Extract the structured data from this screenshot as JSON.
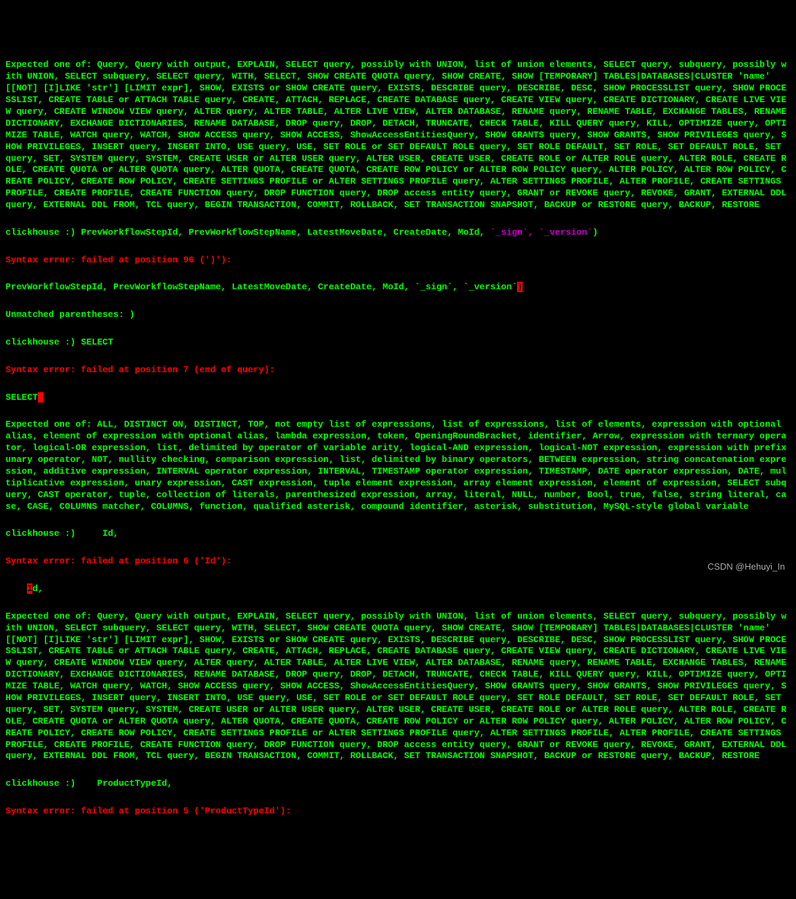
{
  "expected1": "Expected one of: Query, Query with output, EXPLAIN, SELECT query, possibly with UNION, list of union elements, SELECT query, subquery, possibly with UNION, SELECT subquery, SELECT query, WITH, SELECT, SHOW CREATE QUOTA query, SHOW CREATE, SHOW [TEMPORARY] TABLES|DATABASES|CLUSTER 'name' [[NOT] [I]LIKE 'str'] [LIMIT expr], SHOW, EXISTS or SHOW CREATE query, EXISTS, DESCRIBE query, DESCRIBE, DESC, SHOW PROCESSLIST query, SHOW PROCESSLIST, CREATE TABLE or ATTACH TABLE query, CREATE, ATTACH, REPLACE, CREATE DATABASE query, CREATE VIEW query, CREATE DICTIONARY, CREATE LIVE VIEW query, CREATE WINDOW VIEW query, ALTER query, ALTER TABLE, ALTER LIVE VIEW, ALTER DATABASE, RENAME query, RENAME TABLE, EXCHANGE TABLES, RENAME DICTIONARY, EXCHANGE DICTIONARIES, RENAME DATABASE, DROP query, DROP, DETACH, TRUNCATE, CHECK TABLE, KILL QUERY query, KILL, OPTIMIZE query, OPTIMIZE TABLE, WATCH query, WATCH, SHOW ACCESS query, SHOW ACCESS, ShowAccessEntitiesQuery, SHOW GRANTS query, SHOW GRANTS, SHOW PRIVILEGES query, SHOW PRIVILEGES, INSERT query, INSERT INTO, USE query, USE, SET ROLE or SET DEFAULT ROLE query, SET ROLE DEFAULT, SET ROLE, SET DEFAULT ROLE, SET query, SET, SYSTEM query, SYSTEM, CREATE USER or ALTER USER query, ALTER USER, CREATE USER, CREATE ROLE or ALTER ROLE query, ALTER ROLE, CREATE ROLE, CREATE QUOTA or ALTER QUOTA query, ALTER QUOTA, CREATE QUOTA, CREATE ROW POLICY or ALTER ROW POLICY query, ALTER POLICY, ALTER ROW POLICY, CREATE POLICY, CREATE ROW POLICY, CREATE SETTINGS PROFILE or ALTER SETTINGS PROFILE query, ALTER SETTINGS PROFILE, ALTER PROFILE, CREATE SETTINGS PROFILE, CREATE PROFILE, CREATE FUNCTION query, DROP FUNCTION query, DROP access entity query, GRANT or REVOKE query, REVOKE, GRANT, EXTERNAL DDL query, EXTERNAL DDL FROM, TCL query, BEGIN TRANSACTION, COMMIT, ROLLBACK, SET TRANSACTION SNAPSHOT, BACKUP or RESTORE query, BACKUP, RESTORE",
  "prompt1_a": "clickhouse :) PrevWorkflowStepId, PrevWorkflowStepName, LatestMoveDate, CreateDate, MoId, ",
  "prompt1_b": "`_sign`, `_version`",
  "prompt1_c": ")",
  "err1": "Syntax error: failed at position 96 (')'):",
  "echo1_a": "PrevWorkflowStepId, PrevWorkflowStepName, LatestMoveDate, CreateDate, MoId, `_sign`, `_version`",
  "echo1_b": ")",
  "unmatched": "Unmatched parentheses: )",
  "prompt2": "clickhouse :) SELECT",
  "err2": "Syntax error: failed at position 7 (end of query):",
  "select_word": "SELECT",
  "expected2": "Expected one of: ALL, DISTINCT ON, DISTINCT, TOP, not empty list of expressions, list of expressions, list of elements, expression with optional alias, element of expression with optional alias, lambda expression, token, OpeningRoundBracket, identifier, Arrow, expression with ternary operator, logical-OR expression, list, delimited by operator of variable arity, logical-AND expression, logical-NOT expression, expression with prefix unary operator, NOT, nullity checking, comparison expression, list, delimited by binary operators, BETWEEN expression, string concatenation expression, additive expression, INTERVAL operator expression, INTERVAL, TIMESTAMP operator expression, TIMESTAMP, DATE operator expression, DATE, multiplicative expression, unary expression, CAST expression, tuple element expression, array element expression, element of expression, SELECT subquery, CAST operator, tuple, collection of literals, parenthesized expression, array, literal, NULL, number, Bool, true, false, string literal, case, CASE, COLUMNS matcher, COLUMNS, function, qualified asterisk, compound identifier, asterisk, substitution, MySQL-style global variable",
  "prompt3": "clickhouse :)     Id,",
  "err3": "Syntax error: failed at position 6 ('Id'):",
  "id_indent": "    ",
  "id_hl": "I",
  "id_rest": "d,",
  "expected3": "Expected one of: Query, Query with output, EXPLAIN, SELECT query, possibly with UNION, list of union elements, SELECT query, subquery, possibly with UNION, SELECT subquery, SELECT query, WITH, SELECT, SHOW CREATE QUOTA query, SHOW CREATE, SHOW [TEMPORARY] TABLES|DATABASES|CLUSTER 'name' [[NOT] [I]LIKE 'str'] [LIMIT expr], SHOW, EXISTS or SHOW CREATE query, EXISTS, DESCRIBE query, DESCRIBE, DESC, SHOW PROCESSLIST query, SHOW PROCESSLIST, CREATE TABLE or ATTACH TABLE query, CREATE, ATTACH, REPLACE, CREATE DATABASE query, CREATE VIEW query, CREATE DICTIONARY, CREATE LIVE VIEW query, CREATE WINDOW VIEW query, ALTER query, ALTER TABLE, ALTER LIVE VIEW, ALTER DATABASE, RENAME query, RENAME TABLE, EXCHANGE TABLES, RENAME DICTIONARY, EXCHANGE DICTIONARIES, RENAME DATABASE, DROP query, DROP, DETACH, TRUNCATE, CHECK TABLE, KILL QUERY query, KILL, OPTIMIZE query, OPTIMIZE TABLE, WATCH query, WATCH, SHOW ACCESS query, SHOW ACCESS, ShowAccessEntitiesQuery, SHOW GRANTS query, SHOW GRANTS, SHOW PRIVILEGES query, SHOW PRIVILEGES, INSERT query, INSERT INTO, USE query, USE, SET ROLE or SET DEFAULT ROLE query, SET ROLE DEFAULT, SET ROLE, SET DEFAULT ROLE, SET query, SET, SYSTEM query, SYSTEM, CREATE USER or ALTER USER query, ALTER USER, CREATE USER, CREATE ROLE or ALTER ROLE query, ALTER ROLE, CREATE ROLE, CREATE QUOTA or ALTER QUOTA query, ALTER QUOTA, CREATE QUOTA, CREATE ROW POLICY or ALTER ROW POLICY query, ALTER POLICY, ALTER ROW POLICY, CREATE POLICY, CREATE ROW POLICY, CREATE SETTINGS PROFILE or ALTER SETTINGS PROFILE query, ALTER SETTINGS PROFILE, ALTER PROFILE, CREATE SETTINGS PROFILE, CREATE PROFILE, CREATE FUNCTION query, DROP FUNCTION query, DROP access entity query, GRANT or REVOKE query, REVOKE, GRANT, EXTERNAL DDL query, EXTERNAL DDL FROM, TCL query, BEGIN TRANSACTION, COMMIT, ROLLBACK, SET TRANSACTION SNAPSHOT, BACKUP or RESTORE query, BACKUP, RESTORE",
  "prompt4": "clickhouse :)    ProductTypeId,",
  "err4": "Syntax error: failed at position 5 ('ProductTypeId'):",
  "watermark": "CSDN @Hehuyi_In"
}
